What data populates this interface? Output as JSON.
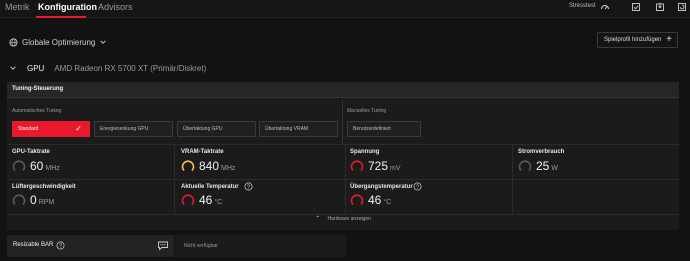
{
  "nav": {
    "tabs": [
      {
        "label": "Metrik"
      },
      {
        "label": "Konfiguration"
      },
      {
        "label": "Advisors"
      }
    ],
    "stress_label": "Stresstest",
    "icons": [
      "stopwatch-icon",
      "export-icon",
      "import-icon",
      "reset-icon"
    ]
  },
  "toolbar": {
    "optimization_label": "Globale Optimierung",
    "profile_button_label": "Spielprofil hinzufügen"
  },
  "gpu": {
    "label": "GPU",
    "name": "AMD Radeon RX 5700 XT (Primär/Diskret)"
  },
  "tuning": {
    "title": "Tuning-Steuerung",
    "auto_section_label": "Automatisches Tuning",
    "manual_section_label": "Manuelles Tuning",
    "auto_buttons": [
      {
        "label": "Standard",
        "active": true
      },
      {
        "label": "Energiesenkung GPU",
        "active": false
      },
      {
        "label": "Übertaktung GPU",
        "active": false
      },
      {
        "label": "Übertaktung VRAM",
        "active": false
      }
    ],
    "manual_button_label": "Benutzerdefiniert",
    "metrics": [
      {
        "label": "GPU-Taktrate",
        "value": "60",
        "unit": "MHz",
        "gauge_color": "#5a5a5a"
      },
      {
        "label": "VRAM-Taktrate",
        "value": "840",
        "unit": "MHz",
        "gauge_color": "#f2c14e"
      },
      {
        "label": "Spannung",
        "value": "725",
        "unit": "mV",
        "gauge_color": "#e8192c"
      },
      {
        "label": "Stromverbrauch",
        "value": "25",
        "unit": "W",
        "gauge_color": "#5a5a5a"
      },
      {
        "label": "Lüftergeschwindigkeit",
        "value": "0",
        "unit": "RPM",
        "gauge_color": "#5a5a5a"
      },
      {
        "label": "Aktuelle Temperatur",
        "value": "46",
        "unit": "°C",
        "gauge_color": "#e8192c"
      },
      {
        "label": "Übergangstemperatur",
        "value": "46",
        "unit": "°C",
        "gauge_color": "#e8192c"
      }
    ],
    "show_hardware_label": "Hardware anzeigen"
  },
  "resizable_bar": {
    "label": "Resizable BAR",
    "value": "Nicht verfügbar"
  },
  "colors": {
    "accent": "#e8192c",
    "background": "#121212",
    "panel": "#1b1b1b"
  }
}
